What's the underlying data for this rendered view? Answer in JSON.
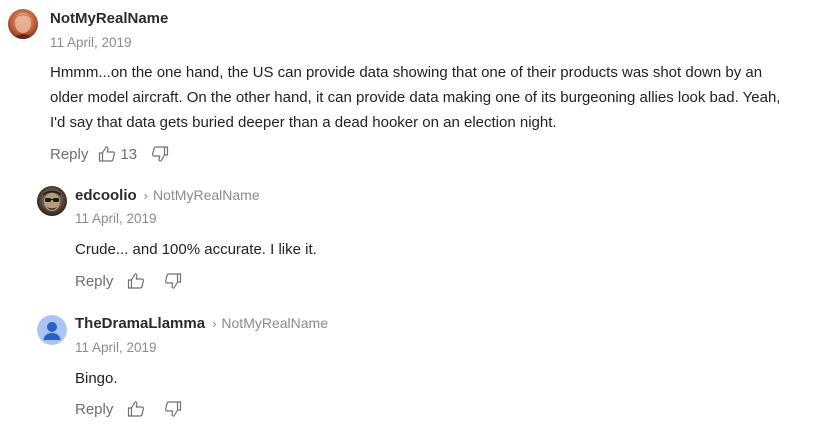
{
  "comments": [
    {
      "author": "NotMyRealName",
      "date": "11 April, 2019",
      "text_lines": [
        "Hmmm...on the one hand, the US can provide data showing that one of their products was shot down by an",
        "older model aircraft. On the other hand, it can provide data making one of its burgeoning allies look bad. Yeah,",
        "I'd say that data gets buried deeper than a dead hooker on an election night."
      ],
      "reply_label": "Reply",
      "likes": "13",
      "avatar_icon": "user-photo-avatar"
    },
    {
      "author": "edcoolio",
      "reply_to": "NotMyRealName",
      "date": "11 April, 2019",
      "text": "Crude... and 100% accurate.  I like it.",
      "reply_label": "Reply",
      "avatar_icon": "user-photo-avatar"
    },
    {
      "author": "TheDramaLlamma",
      "reply_to": "NotMyRealName",
      "date": "11 April, 2019",
      "text": "Bingo.",
      "reply_label": "Reply",
      "avatar_icon": "default-user-avatar"
    }
  ],
  "colors": {
    "meta_gray": "#8a8a8a",
    "action_gray": "#6e6e6e",
    "default_avatar_bg": "#a9c4f5",
    "default_avatar_fg": "#2c5fc9"
  }
}
